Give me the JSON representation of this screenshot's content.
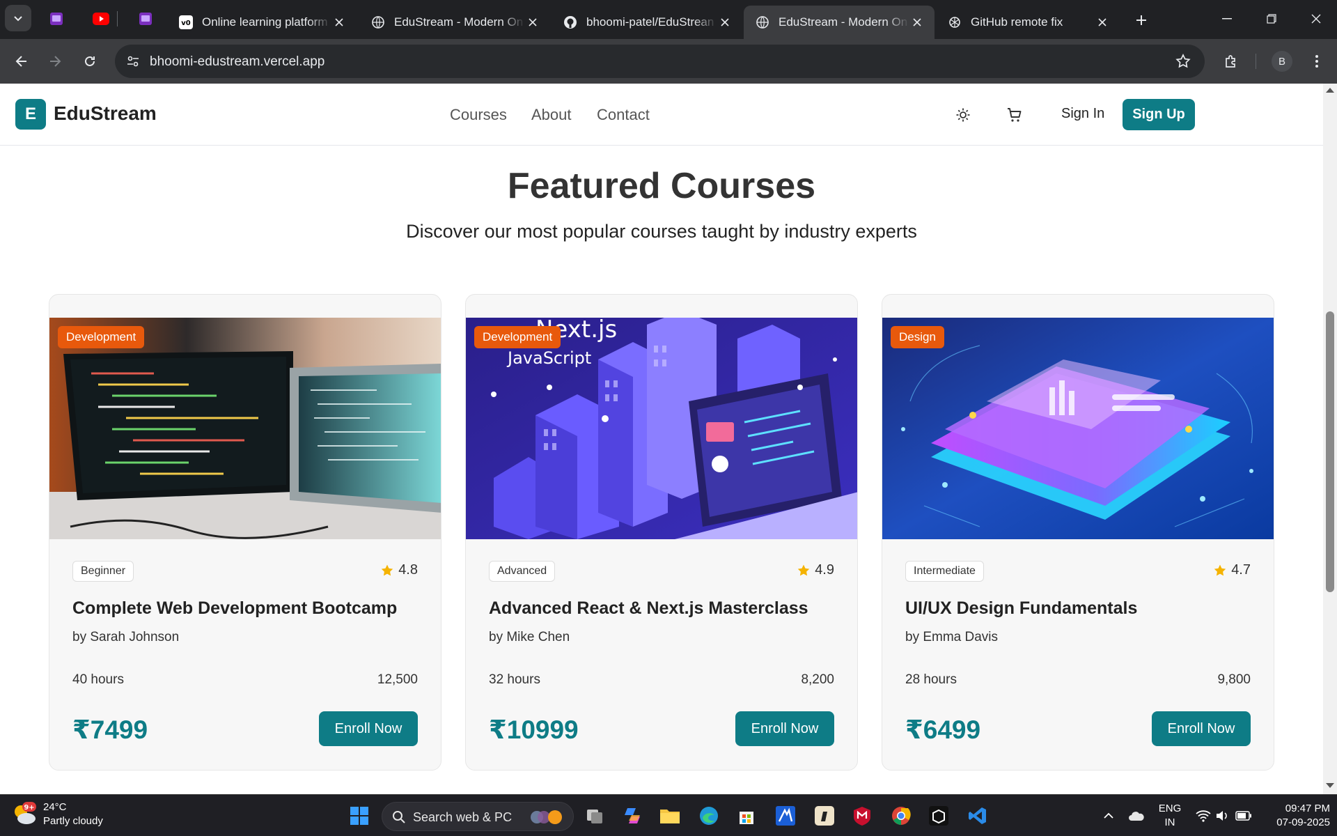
{
  "browser": {
    "tabs": [
      {
        "title": "Online learning platform",
        "favicon": "v0-icon"
      },
      {
        "title": "EduStream - Modern On",
        "favicon": "globe-icon"
      },
      {
        "title": "bhoomi-patel/EduStrean",
        "favicon": "github-icon"
      },
      {
        "title": "EduStream - Modern On",
        "favicon": "globe-icon",
        "active": true
      },
      {
        "title": "GitHub remote fix",
        "favicon": "openai-icon"
      }
    ],
    "url": "bhoomi-edustream.vercel.app",
    "profile_initial": "B"
  },
  "header": {
    "logo_letter": "E",
    "brand": "EduStream",
    "nav": [
      "Courses",
      "About",
      "Contact"
    ],
    "sign_in": "Sign In",
    "sign_up": "Sign Up"
  },
  "section": {
    "title": "Featured Courses",
    "subtitle": "Discover our most popular courses taught by industry experts"
  },
  "courses": [
    {
      "category": "Development",
      "level": "Beginner",
      "rating": "4.8",
      "title": "Complete Web Development Bootcamp",
      "instructor": "by Sarah Johnson",
      "hours": "40 hours",
      "students": "12,500",
      "price": "₹7499",
      "cta": "Enroll Now"
    },
    {
      "category": "Development",
      "level": "Advanced",
      "rating": "4.9",
      "title": "Advanced React & Next.js Masterclass",
      "instructor": "by Mike Chen",
      "hours": "32 hours",
      "students": "8,200",
      "price": "₹10999",
      "cta": "Enroll Now",
      "image_text": {
        "line1": "Next.js",
        "line2": "JavaScript"
      }
    },
    {
      "category": "Design",
      "level": "Intermediate",
      "rating": "4.7",
      "title": "UI/UX Design Fundamentals",
      "instructor": "by Emma Davis",
      "hours": "28 hours",
      "students": "9,800",
      "price": "₹6499",
      "cta": "Enroll Now"
    }
  ],
  "taskbar": {
    "weather_temp": "24°C",
    "weather_desc": "Partly cloudy",
    "weather_badge": "9+",
    "search_placeholder": "Search web & PC",
    "lang_line1": "ENG",
    "lang_line2": "IN",
    "time": "09:47 PM",
    "date": "07-09-2025"
  },
  "colors": {
    "brand_teal": "#0e7c86",
    "category_badge": "#e8590c",
    "star": "#f5b301"
  }
}
